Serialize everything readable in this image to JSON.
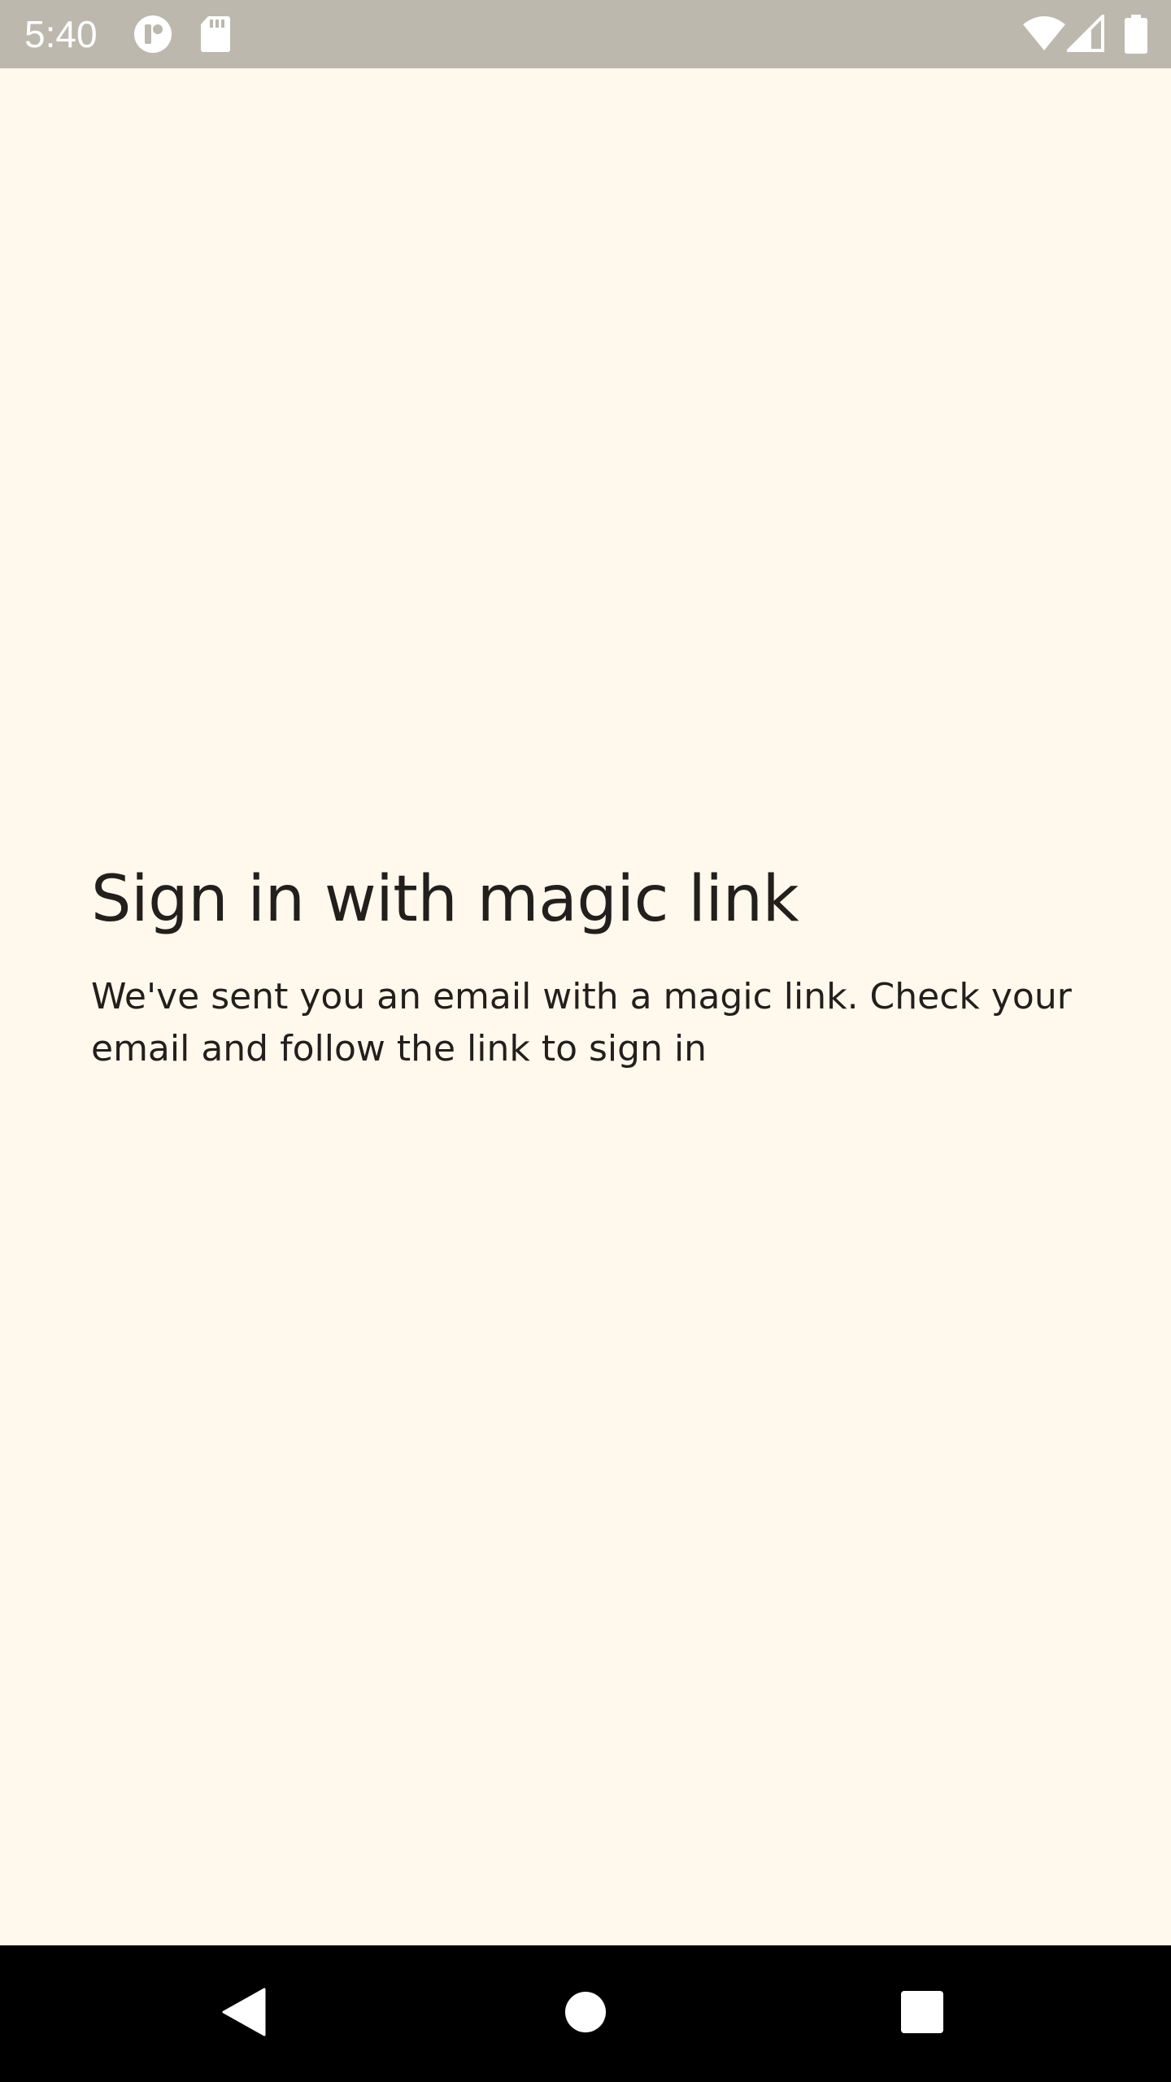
{
  "status_bar": {
    "time": "5:40",
    "icons": [
      "notification-app-icon",
      "sd-card-icon",
      "wifi-icon",
      "cellular-signal-icon",
      "battery-icon"
    ]
  },
  "main": {
    "title": "Sign in with magic link",
    "message": "We've sent you an email with a magic link. Check your email and follow the link to sign in"
  },
  "nav_bar": {
    "icons": [
      "back-icon",
      "home-icon",
      "recents-icon"
    ]
  },
  "colors": {
    "background": "#fff8ec",
    "status_bar": "#bdb8ae",
    "text": "#221f1c",
    "nav_bar": "#000000"
  }
}
